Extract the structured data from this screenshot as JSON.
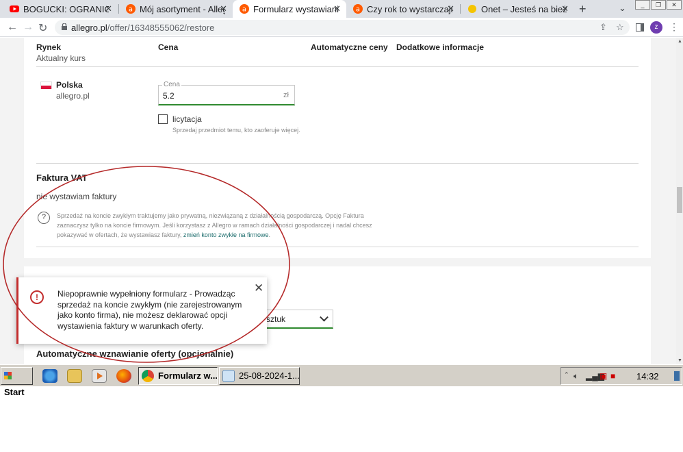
{
  "browser": {
    "tabs": [
      {
        "label": "BOGUCKI: OGRANICZA",
        "favicon": "youtube-icon",
        "color": "#ff0000"
      },
      {
        "label": "Mój asortyment - Alleg",
        "favicon": "allegro-icon",
        "color": "#ff5a00"
      },
      {
        "label": "Formularz wystawiania",
        "favicon": "allegro-icon",
        "color": "#ff5a00"
      },
      {
        "label": "Czy rok to wystarczają",
        "favicon": "allegro-icon",
        "color": "#ff5a00"
      },
      {
        "label": "Onet – Jesteś na bieżą",
        "favicon": "onet-icon",
        "color": "#f5c400"
      }
    ],
    "active_tab_index": 2,
    "url_host": "allegro.pl",
    "url_path": "/offer/16348555062/restore",
    "profile_initial": "z"
  },
  "table_header": {
    "market": "Rynek",
    "market_sub": "Aktualny kurs",
    "price": "Cena",
    "auto_prices": "Automatyczne ceny",
    "extra_info": "Dodatkowe informacje"
  },
  "market_row": {
    "country": "Polska",
    "site": "allegro.pl",
    "price_label": "Cena",
    "price_value": "5.2",
    "price_unit": "zł",
    "auction_label": "licytacja",
    "auction_hint": "Sprzedaj przedmiot temu, kto zaoferuje więcej.",
    "auction_checked": false
  },
  "vat": {
    "title": "Faktura VAT",
    "value": "nie wystawiam faktury",
    "info": "Sprzedaż na koncie zwykłym traktujemy jako prywatną, niezwiązaną z działalnością gospodarczą. Opcję Faktura zaznaczysz tylko na koncie firmowym. Jeśli korzystasz z Allegro w ramach działalności gospodarczej i nadal chcesz pokazywać w ofertach, że wystawiasz faktury,",
    "link": "zmień konto zwykłe na firmowe",
    "info_end": "."
  },
  "quantity": {
    "unit_value": "sztuk"
  },
  "auto_renew": {
    "title": "Automatyczne wznawianie oferty (opcjonalnie)"
  },
  "toast": {
    "message": "Niepoprawnie wypełniony formularz - Prowadząc sprzedaż na koncie zwykłym (nie zarejestrowanym jako konto firma), nie możesz deklarować opcji wystawienia faktury w warunkach oferty.",
    "icon": "exclamation-icon",
    "accent": "#c32d2d"
  },
  "annotation": {
    "color": "#b52a2a"
  },
  "taskbar": {
    "start_label": "Start",
    "tasks": [
      {
        "label": "Formularz w...",
        "icon": "chrome-icon"
      },
      {
        "label": "25-08-2024-1...",
        "icon": "paint-icon"
      }
    ],
    "clock": "14:32"
  }
}
